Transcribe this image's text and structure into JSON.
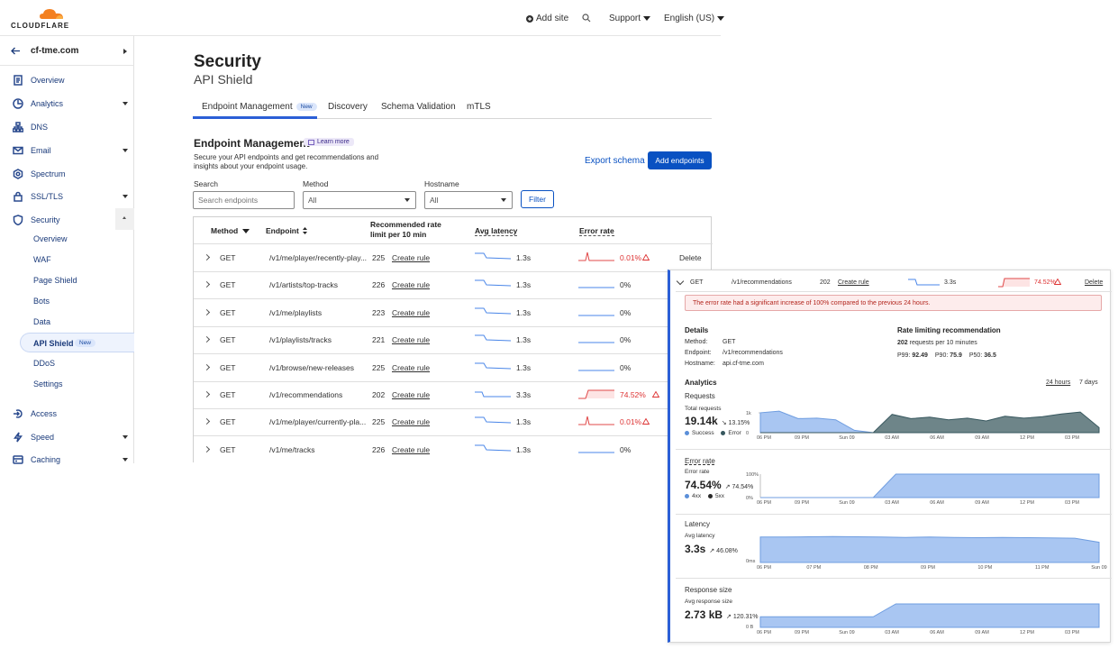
{
  "header": {
    "logo_text": "CLOUDFLARE",
    "add_site": "Add site",
    "support": "Support",
    "language": "English (US)",
    "brand_color": "#f38020"
  },
  "sidebar": {
    "account": "cf-tme.com",
    "items": [
      {
        "label": "Overview",
        "icon": "document-icon"
      },
      {
        "label": "Analytics",
        "icon": "clock-chart-icon",
        "caret": true
      },
      {
        "label": "DNS",
        "icon": "network-icon"
      },
      {
        "label": "Email",
        "icon": "email-icon",
        "caret": true
      },
      {
        "label": "Spectrum",
        "icon": "spectrum-icon"
      },
      {
        "label": "SSL/TLS",
        "icon": "lock-icon",
        "caret": true
      },
      {
        "label": "Security",
        "icon": "shield-icon",
        "expanded": true
      }
    ],
    "security_sub": [
      "Overview",
      "WAF",
      "Page Shield",
      "Bots",
      "Data",
      "API Shield",
      "DDoS",
      "Settings"
    ],
    "active_sub": "API Shield",
    "new_badge": "New",
    "items_after": [
      {
        "label": "Access",
        "icon": "access-icon"
      },
      {
        "label": "Speed",
        "icon": "bolt-icon",
        "caret": true
      },
      {
        "label": "Caching",
        "icon": "caching-icon",
        "caret": true
      }
    ]
  },
  "main": {
    "title": "Security",
    "subtitle": "API Shield",
    "tabs": [
      "Endpoint Management",
      "Discovery",
      "Schema Validation",
      "mTLS"
    ],
    "tab_badge": "New",
    "section_title": "Endpoint Management",
    "learn_more": "Learn more",
    "description": "Secure your API endpoints and get recommendations and insights about your endpoint usage.",
    "export_schema": "Export schema",
    "add_endpoints": "Add endpoints",
    "filters": {
      "search_label": "Search",
      "search_placeholder": "Search endpoints",
      "method_label": "Method",
      "method_value": "All",
      "hostname_label": "Hostname",
      "hostname_value": "All",
      "filter_button": "Filter"
    }
  },
  "table": {
    "headers": {
      "method": "Method",
      "endpoint": "Endpoint",
      "rate_line1": "Recommended rate",
      "rate_line2": "limit per 10 min",
      "latency": "Avg latency",
      "error": "Error rate"
    },
    "create_rule": "Create rule",
    "delete": "Delete",
    "rows": [
      {
        "method": "GET",
        "endpoint": "/v1/me/player/recently-play...",
        "rate": "225",
        "latency": "1.3s",
        "error": "0.01%",
        "error_level": "spike"
      },
      {
        "method": "GET",
        "endpoint": "/v1/artists/top-tracks",
        "rate": "226",
        "latency": "1.3s",
        "error": "0%",
        "error_level": "flat"
      },
      {
        "method": "GET",
        "endpoint": "/v1/me/playlists",
        "rate": "223",
        "latency": "1.3s",
        "error": "0%",
        "error_level": "flat"
      },
      {
        "method": "GET",
        "endpoint": "/v1/playlists/tracks",
        "rate": "221",
        "latency": "1.3s",
        "error": "0%",
        "error_level": "flat"
      },
      {
        "method": "GET",
        "endpoint": "/v1/browse/new-releases",
        "rate": "225",
        "latency": "1.3s",
        "error": "0%",
        "error_level": "flat"
      },
      {
        "method": "GET",
        "endpoint": "/v1/recommendations",
        "rate": "202",
        "latency": "3.3s",
        "error": "74.52%",
        "error_level": "step"
      },
      {
        "method": "GET",
        "endpoint": "/v1/me/player/currently-pla...",
        "rate": "225",
        "latency": "1.3s",
        "error": "0.01%",
        "error_level": "spike"
      },
      {
        "method": "GET",
        "endpoint": "/v1/me/tracks",
        "rate": "226",
        "latency": "1.3s",
        "error": "0%",
        "error_level": "flat"
      }
    ]
  },
  "detail": {
    "method": "GET",
    "endpoint": "/v1/recommendations",
    "rate": "202",
    "create_rule": "Create rule",
    "latency": "3.3s",
    "error": "74.52%",
    "delete": "Delete",
    "alert": "The error rate had a significant increase of 100% compared to the previous 24 hours.",
    "details_title": "Details",
    "details": [
      {
        "k": "Method:",
        "v": "GET"
      },
      {
        "k": "Endpoint:",
        "v": "/v1/recommendations"
      },
      {
        "k": "Hostname:",
        "v": "api.cf-tme.com"
      }
    ],
    "rate_title": "Rate limiting recommendation",
    "rate_value": "202",
    "rate_unit": "requests per 10 minutes",
    "percentiles": [
      {
        "k": "P99:",
        "v": "92.49"
      },
      {
        "k": "P90:",
        "v": "75.9"
      },
      {
        "k": "P50:",
        "v": "36.5"
      }
    ],
    "analytics_title": "Analytics",
    "range_24h": "24 hours",
    "range_7d": "7 days",
    "requests": {
      "title": "Requests",
      "label": "Total requests",
      "value": "19.14k",
      "delta": "↘ 13.15%",
      "legend": [
        "Success",
        "Error"
      ],
      "y_ticks": [
        "1k",
        "0"
      ],
      "x_ticks": [
        "06 PM",
        "09 PM",
        "Sun 09",
        "03 AM",
        "06 AM",
        "09 AM",
        "12 PM",
        "03 PM"
      ],
      "success": [
        0.85,
        0.92,
        0.6,
        0.62,
        0.55,
        0.1,
        0.0,
        0.0,
        0.0,
        0.0,
        0.0,
        0.0,
        0.0,
        0.0,
        0.0,
        0.0,
        0.0,
        0.0,
        0.0
      ],
      "error": [
        0.0,
        0.0,
        0.0,
        0.0,
        0.0,
        0.0,
        0.0,
        0.78,
        0.6,
        0.66,
        0.55,
        0.62,
        0.5,
        0.7,
        0.62,
        0.68,
        0.8,
        0.88,
        0.22
      ]
    },
    "error_rate": {
      "title": "Error rate",
      "label": "Error rate",
      "value": "74.54%",
      "delta": "↗ 74.54%",
      "legend": [
        "4xx",
        "5xx"
      ],
      "y_ticks": [
        "100%",
        "0%"
      ],
      "x_ticks": [
        "06 PM",
        "09 PM",
        "Sun 09",
        "03 AM",
        "06 AM",
        "09 AM",
        "12 PM",
        "03 PM"
      ],
      "values": [
        0.0,
        0.0,
        0.0,
        0.0,
        0.0,
        0.0,
        1.0,
        1.0,
        1.0,
        1.0,
        1.0,
        1.0,
        1.0,
        1.0,
        1.0,
        1.0
      ]
    },
    "latency_chart": {
      "title": "Latency",
      "label": "Avg latency",
      "value": "3.3s",
      "delta": "↗ 46.08%",
      "y_ticks": [
        "0ms"
      ],
      "x_ticks": [
        "06 PM",
        "07 PM",
        "08 PM",
        "09 PM",
        "10 PM",
        "11 PM",
        "Sun 09"
      ],
      "values": [
        0.88,
        0.88,
        0.89,
        0.9,
        0.89,
        0.88,
        0.87,
        0.88,
        0.87,
        0.86,
        0.87,
        0.86,
        0.85,
        0.84,
        0.7
      ]
    },
    "response_size": {
      "title": "Response size",
      "label": "Avg response size",
      "value": "2.73 kB",
      "delta": "↗ 120.31%",
      "y_ticks": [
        "0 B"
      ],
      "x_ticks": [
        "06 PM",
        "09 PM",
        "Sun 09",
        "03 AM",
        "06 AM",
        "09 AM",
        "12 PM",
        "03 PM"
      ],
      "values": [
        0.45,
        0.45,
        0.45,
        0.45,
        0.45,
        0.45,
        1.0,
        1.0,
        1.0,
        1.0,
        1.0,
        1.0,
        1.0,
        1.0,
        1.0,
        1.0
      ]
    }
  }
}
